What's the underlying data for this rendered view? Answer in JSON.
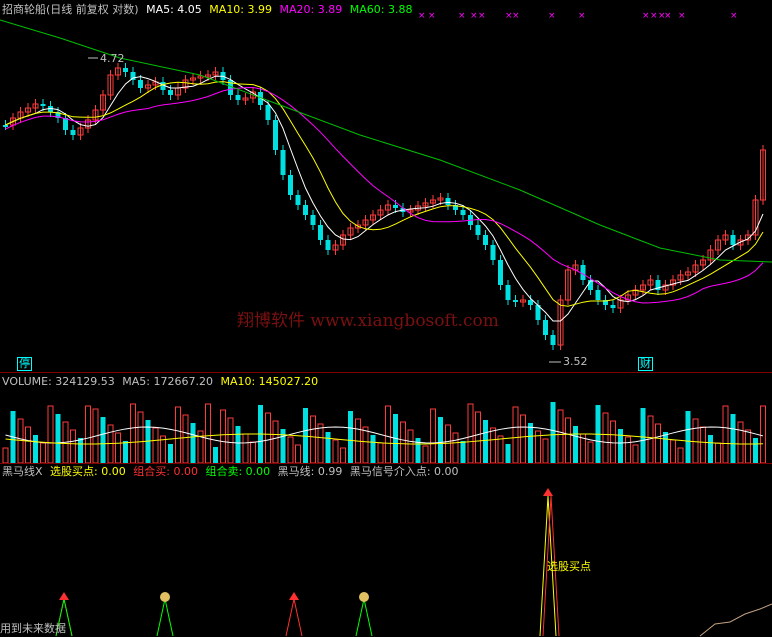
{
  "main": {
    "title": "招商轮船(日线 前复权 对数)",
    "ma": [
      {
        "label": "MA5: 4.05",
        "color": "#ffffff"
      },
      {
        "label": "MA10: 3.99",
        "color": "#ffff00"
      },
      {
        "label": "MA20: 3.89",
        "color": "#ff00ff"
      },
      {
        "label": "MA60: 3.88",
        "color": "#00ff00"
      }
    ],
    "high_label": "4.72",
    "low_label": "3.52",
    "badge_left": "停",
    "badge_right": "财",
    "watermark": "翔博软件 www.xiangbosoft.com",
    "x_marks": "×"
  },
  "volume": {
    "label_volume": "VOLUME: 324129.53",
    "label_ma5": "MA5: 172667.20",
    "label_ma10": "MA10: 145027.20"
  },
  "indicator": {
    "items": [
      {
        "label": "黑马线X",
        "color": "#c0c0c0"
      },
      {
        "label": "选股买点: 0.00",
        "color": "#ffff00"
      },
      {
        "label": "组合买: 0.00",
        "color": "#ff3030"
      },
      {
        "label": "组合卖: 0.00",
        "color": "#00ff00"
      },
      {
        "label": "黑马线: 0.99",
        "color": "#c0c0c0"
      },
      {
        "label": "黑马信号介入点: 0.00",
        "color": "#c0c0c0"
      }
    ],
    "buy_label": "选股买点"
  },
  "footer": "用到未来数据",
  "chart_data": {
    "type": "candlestick",
    "title": "招商轮船(日线 前复权 对数)",
    "annotations": [
      "4.72",
      "3.52"
    ],
    "ma_values": {
      "MA5": 4.05,
      "MA10": 3.99,
      "MA20": 3.89,
      "MA60": 3.88
    },
    "volume": {
      "VOLUME": 324129.53,
      "MA5": 172667.2,
      "MA10": 145027.2
    },
    "indicator": {
      "选股买点": 0.0,
      "组合买": 0.0,
      "组合卖": 0.0,
      "黑马线": 0.99,
      "黑马信号介入点": 0.0
    }
  }
}
